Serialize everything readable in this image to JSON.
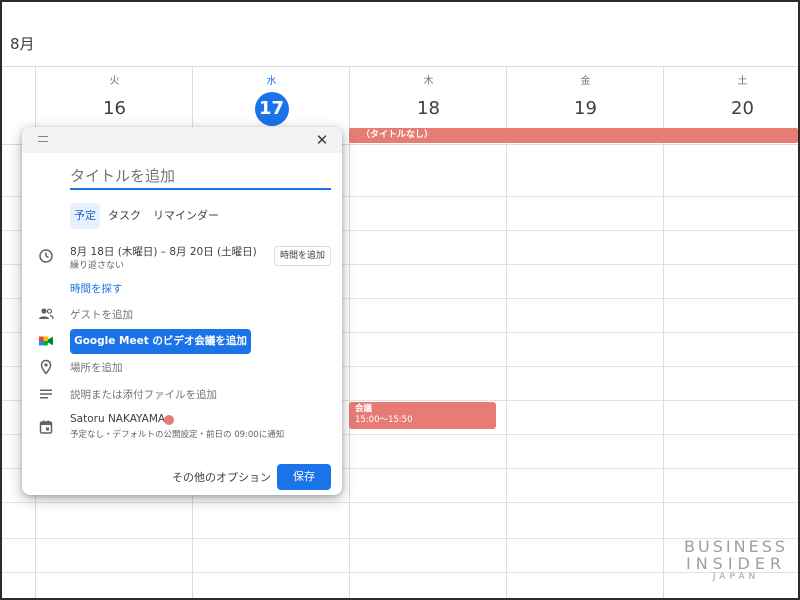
{
  "calendar": {
    "month": "8月",
    "days": [
      {
        "dow": "火",
        "num": "16"
      },
      {
        "dow": "水",
        "num": "17"
      },
      {
        "dow": "木",
        "num": "18"
      },
      {
        "dow": "金",
        "num": "19"
      },
      {
        "dow": "土",
        "num": "20"
      }
    ],
    "allday_event": "（タイトルなし）",
    "meeting": {
      "title": "会議",
      "time": "15:00～15:50"
    }
  },
  "dialog": {
    "title_placeholder": "タイトルを追加",
    "tabs": [
      "予定",
      "タスク",
      "リマインダー"
    ],
    "date_range": "8月 18日 (木曜日)  –  8月 20日 (土曜日)",
    "repeat": "繰り返さない",
    "add_time": "時間を追加",
    "find_time": "時間を探す",
    "add_guest": "ゲストを追加",
    "meet_button": "Google Meet のビデオ会議を追加",
    "add_place": "場所を追加",
    "add_description": "説明または添付ファイルを追加",
    "owner": "Satoru NAKAYAMA",
    "owner_color": "#e67c73",
    "notification": "予定なし・デフォルトの公開設定・前日の 09:00に通知",
    "more_options": "その他のオプション",
    "save": "保存"
  },
  "watermark": {
    "line1": "BUSINESS",
    "line2": "INSIDER",
    "line3": "JAPAN"
  },
  "colors": {
    "accent": "#1a73e8",
    "event": "#e67c73"
  }
}
